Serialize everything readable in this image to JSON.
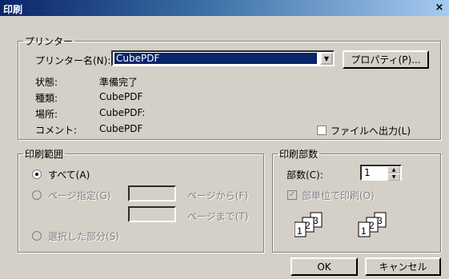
{
  "window": {
    "title": "印刷",
    "close_glyph": "×"
  },
  "printer": {
    "group_label": "プリンター",
    "name_label": "プリンター名(N):",
    "name_value": "CubePDF",
    "properties_button": "プロパティ(P)...",
    "status_label": "状態:",
    "status_value": "準備完了",
    "type_label": "種類:",
    "type_value": "CubePDF",
    "location_label": "場所:",
    "location_value": "CubePDF:",
    "comment_label": "コメント:",
    "comment_value": "CubePDF",
    "print_to_file_label": "ファイルへ出力(L)",
    "print_to_file_checked": false
  },
  "range": {
    "group_label": "印刷範囲",
    "all_label": "すべて(A)",
    "pages_label": "ページ指定(G)",
    "from_label": "ページから(F)",
    "to_label": "ページまで(T)",
    "selection_label": "選択した部分(S)"
  },
  "copies": {
    "group_label": "印刷部数",
    "count_label": "部数(C):",
    "count_value": "1",
    "collate_label": "部単位で印刷(O)",
    "collate_checked": true,
    "icon_page_numbers": [
      "1",
      "2",
      "3"
    ]
  },
  "buttons": {
    "ok": "OK",
    "cancel": "キャンセル"
  }
}
